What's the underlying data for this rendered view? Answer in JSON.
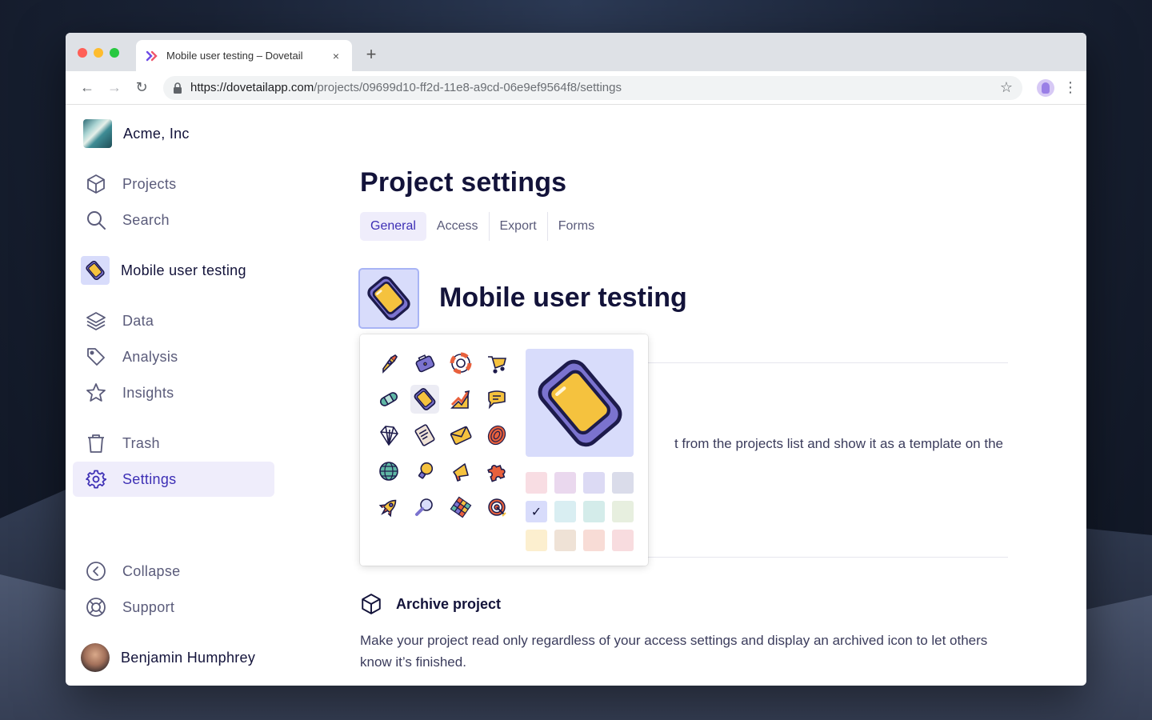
{
  "browser": {
    "tab_title": "Mobile user testing – Dovetail",
    "url_host": "https://dovetailapp.com",
    "url_path": "/projects/09699d10-ff2d-11e8-a9cd-06e9ef9564f8/settings",
    "close_glyph": "×",
    "newtab_glyph": "+",
    "back_glyph": "←",
    "forward_glyph": "→",
    "reload_glyph": "↻",
    "star_glyph": "☆",
    "menu_glyph": "⋮"
  },
  "sidebar": {
    "org_name": "Acme, Inc",
    "items": [
      {
        "label": "Projects",
        "icon": "cube-icon"
      },
      {
        "label": "Search",
        "icon": "search-icon"
      },
      {
        "label": "Mobile user testing",
        "icon": "phone-icon"
      },
      {
        "label": "Data",
        "icon": "layers-icon"
      },
      {
        "label": "Analysis",
        "icon": "tag-icon"
      },
      {
        "label": "Insights",
        "icon": "star-icon"
      },
      {
        "label": "Trash",
        "icon": "trash-icon"
      },
      {
        "label": "Settings",
        "icon": "gear-icon"
      },
      {
        "label": "Collapse",
        "icon": "chevron-left-circle-icon"
      },
      {
        "label": "Support",
        "icon": "lifebuoy-icon"
      }
    ],
    "user_name": "Benjamin Humphrey"
  },
  "main": {
    "title": "Project settings",
    "tabs": [
      "General",
      "Access",
      "Export",
      "Forms"
    ],
    "active_tab": "General",
    "project_name": "Mobile user testing",
    "partial_description": "t from the projects list and show it as a template on the",
    "archive": {
      "title": "Archive project",
      "description": "Make your project read only regardless of your access settings and display an archived icon to let others know it’s finished."
    }
  },
  "icon_picker": {
    "icons": [
      "rocket-icon",
      "suitcase-icon",
      "lifebuoy-icon",
      "shopping-cart-icon",
      "bandage-icon",
      "phone-icon",
      "chart-up-icon",
      "speech-bubble-icon",
      "diamond-icon",
      "document-icon",
      "envelope-icon",
      "fingerprint-icon",
      "globe-icon",
      "lightbulb-icon",
      "megaphone-icon",
      "puzzle-icon",
      "rocket-launch-icon",
      "magnifier-icon",
      "rubiks-cube-icon",
      "target-icon"
    ],
    "selected_icon": "phone-icon",
    "swatch_colors": [
      "#f8dde3",
      "#ead8ee",
      "#dcdaf4",
      "#dadcea",
      "#d8dcfb",
      "#d9eef2",
      "#d4ecea",
      "#e7efdf",
      "#fcefcf",
      "#efe2d6",
      "#f8dcd6",
      "#f8dcdf"
    ],
    "selected_swatch": 4,
    "check_glyph": "✓"
  },
  "colors": {
    "accent": "#3d2fb5",
    "accent_bg": "#efedfb",
    "heading": "#13133a",
    "icon_yellow": "#f5c23e",
    "icon_purple": "#7b73cf"
  }
}
